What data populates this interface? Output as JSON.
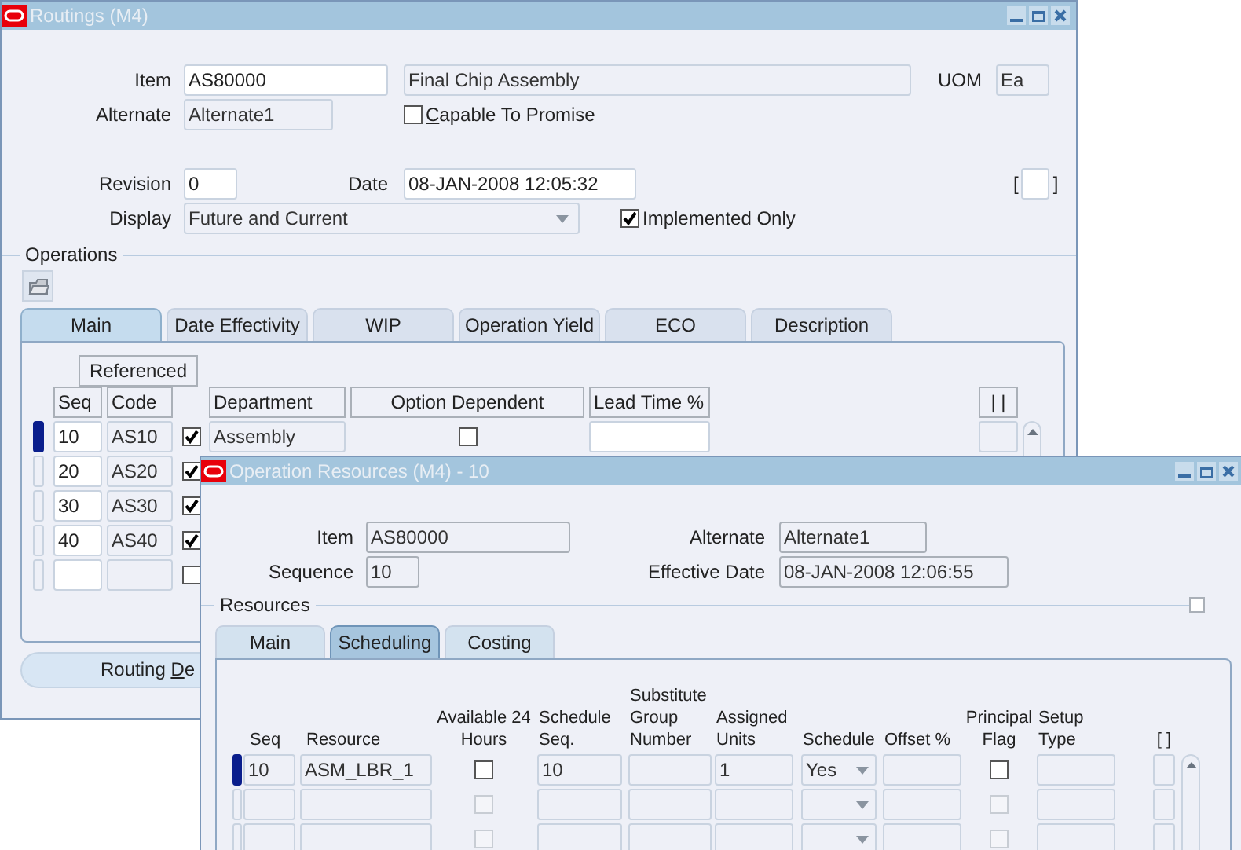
{
  "routings_window": {
    "title": "Routings (M4)",
    "item": {
      "label": "Item",
      "value": "AS80000"
    },
    "description": "Final Chip Assembly",
    "uom": {
      "label": "UOM",
      "value": "Ea"
    },
    "alternate": {
      "label": "Alternate",
      "value": "Alternate1"
    },
    "capable_to_promise": {
      "label": "Capable To Promise",
      "checked": false
    },
    "revision": {
      "label": "Revision",
      "value": "0"
    },
    "date": {
      "label": "Date",
      "value": "08-JAN-2008 12:05:32"
    },
    "folder_marker": "[ ]",
    "display": {
      "label": "Display",
      "value": "Future and Current"
    },
    "implemented_only": {
      "label": "Implemented Only",
      "checked": true
    },
    "operations_label": "Operations",
    "tabs": [
      {
        "label": "Main",
        "selected": true
      },
      {
        "label": "Date Effectivity",
        "selected": false
      },
      {
        "label": "WIP",
        "selected": false
      },
      {
        "label": "Operation Yield",
        "selected": false
      },
      {
        "label": "ECO",
        "selected": false
      },
      {
        "label": "Description",
        "selected": false
      }
    ],
    "group_header": "Referenced",
    "columns": [
      "Seq",
      "Code",
      "Department",
      "Option Dependent",
      "Lead Time %",
      "| |"
    ],
    "rows": [
      {
        "current": true,
        "seq": "10",
        "code": "AS10",
        "referenced": true,
        "department": "Assembly",
        "option_dependent": false
      },
      {
        "current": false,
        "seq": "20",
        "code": "AS20",
        "referenced": true
      },
      {
        "current": false,
        "seq": "30",
        "code": "AS30",
        "referenced": true
      },
      {
        "current": false,
        "seq": "40",
        "code": "AS40",
        "referenced": true
      },
      {
        "current": false,
        "referenced": false
      }
    ],
    "details_button": {
      "label": "Routing De"
    }
  },
  "resources_window": {
    "title": "Operation Resources (M4) - 10",
    "item": {
      "label": "Item",
      "value": "AS80000"
    },
    "sequence": {
      "label": "Sequence",
      "value": "10"
    },
    "alternate": {
      "label": "Alternate",
      "value": "Alternate1"
    },
    "effective_date": {
      "label": "Effective Date",
      "value": "08-JAN-2008 12:06:55"
    },
    "resources_label": "Resources",
    "resources_checkbox": {
      "checked": false
    },
    "tabs": [
      {
        "label": "Main",
        "selected": false
      },
      {
        "label": "Scheduling",
        "selected": true
      },
      {
        "label": "Costing",
        "selected": false
      }
    ],
    "columns": [
      "Seq",
      "Resource",
      "Available 24 Hours",
      "Schedule Seq.",
      "Substitute Group Number",
      "Assigned Units",
      "Schedule",
      "Offset %",
      "Principal Flag",
      "Setup Type",
      "[ ]"
    ],
    "rows": [
      {
        "current": true,
        "disabled": false,
        "seq": "10",
        "resource": "ASM_LBR_1",
        "available_24_hours": false,
        "schedule_seq": "10",
        "assigned_units": "1",
        "schedule": "Yes",
        "principal_flag": false
      },
      {
        "current": false,
        "disabled": true,
        "available_24_hours": false,
        "principal_flag": false
      },
      {
        "current": false,
        "disabled": true,
        "available_24_hours": false,
        "principal_flag": false
      }
    ]
  }
}
